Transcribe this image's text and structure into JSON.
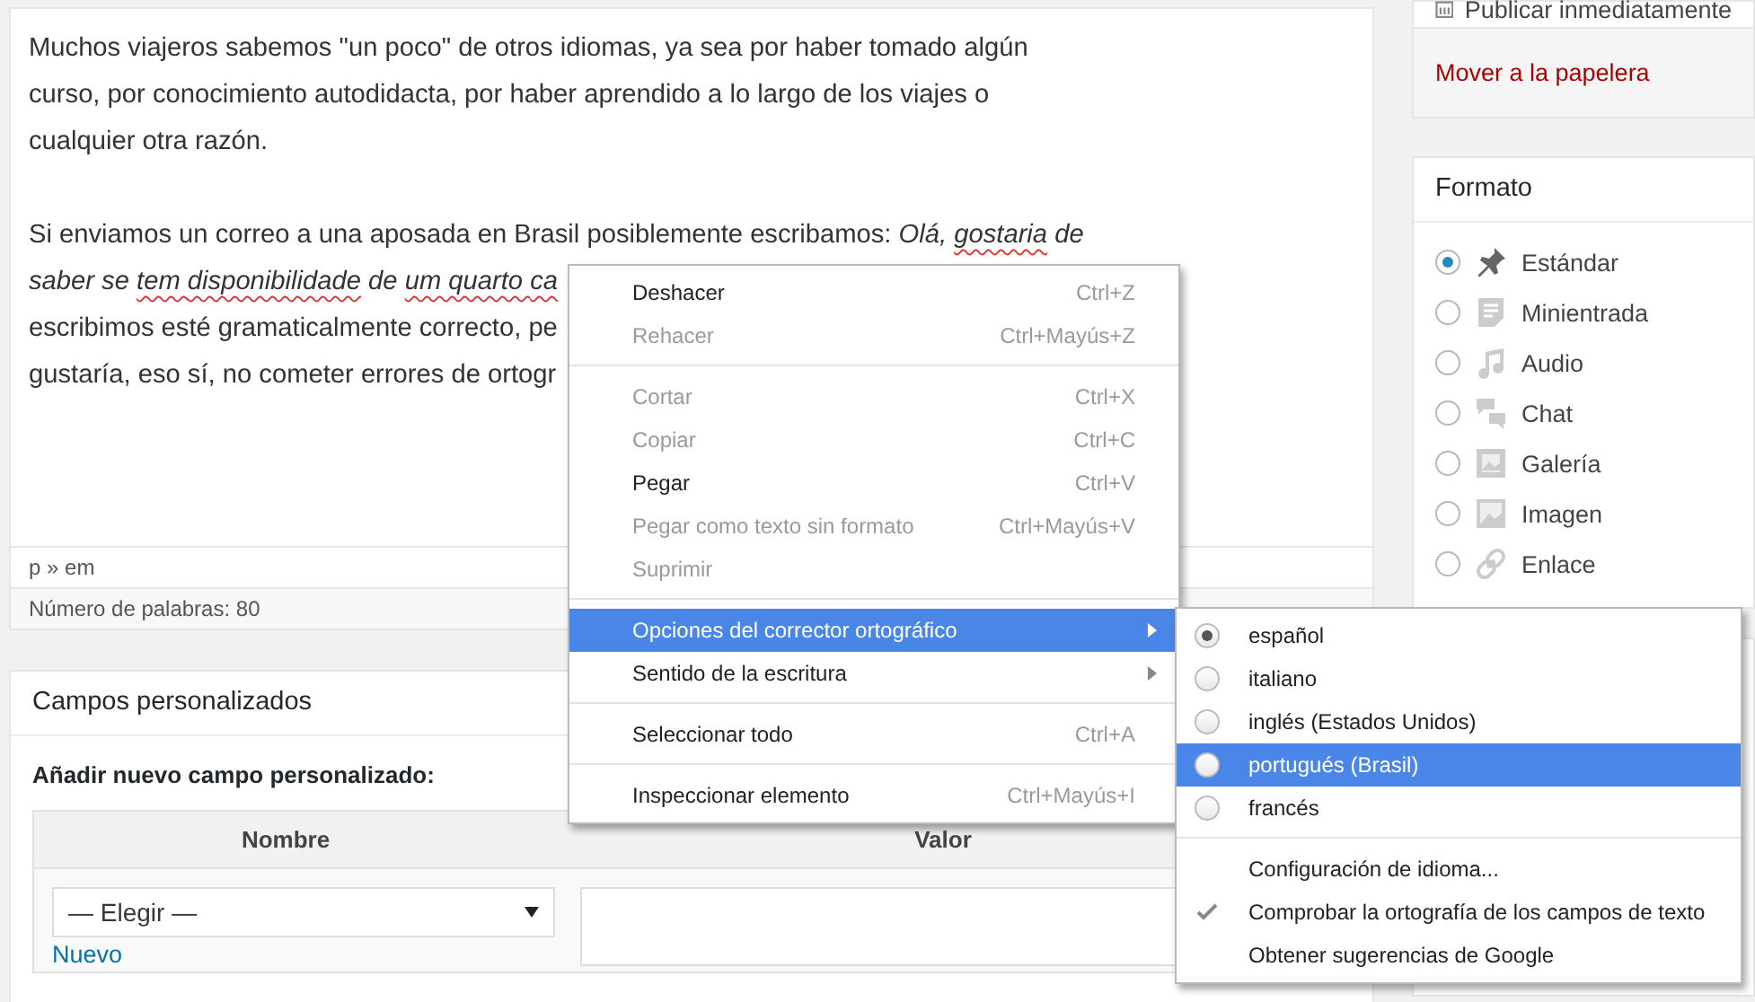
{
  "editor": {
    "paragraphs": [
      {
        "lines": [
          [
            {
              "kind": "plain",
              "text": "Muchos viajeros sabemos \"un poco\" de otros idiomas, ya sea por haber tomado algún"
            }
          ],
          [
            {
              "kind": "plain",
              "text": "curso, por conocimiento autodidacta, por haber aprendido a lo largo de los viajes o"
            }
          ],
          [
            {
              "kind": "plain",
              "text": "cualquier otra razón."
            }
          ]
        ]
      },
      {
        "lines": [
          [
            {
              "kind": "plain",
              "text": "Si enviamos un correo a una aposada en Brasil posiblemente escribamos: "
            },
            {
              "kind": "italic",
              "text": "Olá, "
            },
            {
              "kind": "misspelled",
              "text": "gostaria"
            },
            {
              "kind": "italic",
              "text": " de"
            }
          ],
          [
            {
              "kind": "italic",
              "text": "saber se "
            },
            {
              "kind": "misspelled",
              "text": "tem "
            },
            {
              "kind": "misspelled",
              "text": "disponibilidade"
            },
            {
              "kind": "italic",
              "text": " de "
            },
            {
              "kind": "misspelled",
              "text": "um quarto "
            },
            {
              "kind": "misspelled",
              "text": "ca"
            }
          ],
          [
            {
              "kind": "plain",
              "text": "escribimos esté gramaticalmente correcto, pe"
            }
          ],
          [
            {
              "kind": "plain",
              "text": "gustaría, eso sí, no cometer errores de ortogr"
            }
          ]
        ]
      }
    ],
    "path": "p » em",
    "word_count": "Número de palabras: 80"
  },
  "custom_fields": {
    "title": "Campos personalizados",
    "add_label": "Añadir nuevo campo personalizado:",
    "columns": [
      "Nombre",
      "Valor"
    ],
    "select": {
      "value": "— Elegir —"
    },
    "new_link": "Nuevo"
  },
  "publish": {
    "label": "Publicar inmediatamente",
    "trash_link": "Mover a la papelera"
  },
  "format": {
    "title": "Formato",
    "options": [
      {
        "kind": "pin",
        "label": "Estándar",
        "selected": true
      },
      {
        "kind": "aside",
        "label": "Minientrada",
        "selected": false
      },
      {
        "kind": "audio",
        "label": "Audio",
        "selected": false
      },
      {
        "kind": "chat",
        "label": "Chat",
        "selected": false
      },
      {
        "kind": "gallery",
        "label": "Galería",
        "selected": false
      },
      {
        "kind": "image",
        "label": "Imagen",
        "selected": false
      },
      {
        "kind": "link",
        "label": "Enlace",
        "selected": false
      }
    ]
  },
  "context_menu": {
    "items": [
      {
        "kind": "item",
        "label": "Deshacer",
        "shortcut": "Ctrl+Z",
        "disabled": false,
        "highlighted": false,
        "has_submenu": false
      },
      {
        "kind": "item",
        "label": "Rehacer",
        "shortcut": "Ctrl+Mayús+Z",
        "disabled": true,
        "highlighted": false,
        "has_submenu": false
      },
      {
        "kind": "separator"
      },
      {
        "kind": "item",
        "label": "Cortar",
        "shortcut": "Ctrl+X",
        "disabled": true,
        "highlighted": false,
        "has_submenu": false
      },
      {
        "kind": "item",
        "label": "Copiar",
        "shortcut": "Ctrl+C",
        "disabled": true,
        "highlighted": false,
        "has_submenu": false
      },
      {
        "kind": "item",
        "label": "Pegar",
        "shortcut": "Ctrl+V",
        "disabled": false,
        "highlighted": false,
        "has_submenu": false
      },
      {
        "kind": "item",
        "label": "Pegar como texto sin formato",
        "shortcut": "Ctrl+Mayús+V",
        "disabled": true,
        "highlighted": false,
        "has_submenu": false
      },
      {
        "kind": "item",
        "label": "Suprimir",
        "disabled": true,
        "highlighted": false,
        "has_submenu": false
      },
      {
        "kind": "separator"
      },
      {
        "kind": "item",
        "label": "Opciones del corrector ortográfico",
        "disabled": false,
        "highlighted": true,
        "has_submenu": true
      },
      {
        "kind": "item",
        "label": "Sentido de la escritura",
        "disabled": false,
        "highlighted": false,
        "has_submenu": true
      },
      {
        "kind": "separator"
      },
      {
        "kind": "item",
        "label": "Seleccionar todo",
        "shortcut": "Ctrl+A",
        "disabled": false,
        "highlighted": false,
        "has_submenu": false
      },
      {
        "kind": "separator"
      },
      {
        "kind": "item",
        "label": "Inspeccionar elemento",
        "shortcut": "Ctrl+Mayús+I",
        "disabled": false,
        "highlighted": false,
        "has_submenu": false
      }
    ]
  },
  "submenu": {
    "items": [
      {
        "kind": "radio",
        "label": "español",
        "selected": true,
        "highlighted": false
      },
      {
        "kind": "radio",
        "label": "italiano",
        "selected": false,
        "highlighted": false
      },
      {
        "kind": "radio",
        "label": "inglés (Estados Unidos)",
        "selected": false,
        "highlighted": false
      },
      {
        "kind": "radio",
        "label": "portugués (Brasil)",
        "selected": false,
        "highlighted": true
      },
      {
        "kind": "radio",
        "label": "francés",
        "selected": false,
        "highlighted": false
      },
      {
        "kind": "separator"
      },
      {
        "kind": "check",
        "label": "Configuración de idioma...",
        "checked": false
      },
      {
        "kind": "check",
        "label": "Comprobar la ortografía de los campos de texto",
        "checked": true
      },
      {
        "kind": "check",
        "label": "Obtener sugerencias de Google",
        "checked": false
      }
    ]
  }
}
